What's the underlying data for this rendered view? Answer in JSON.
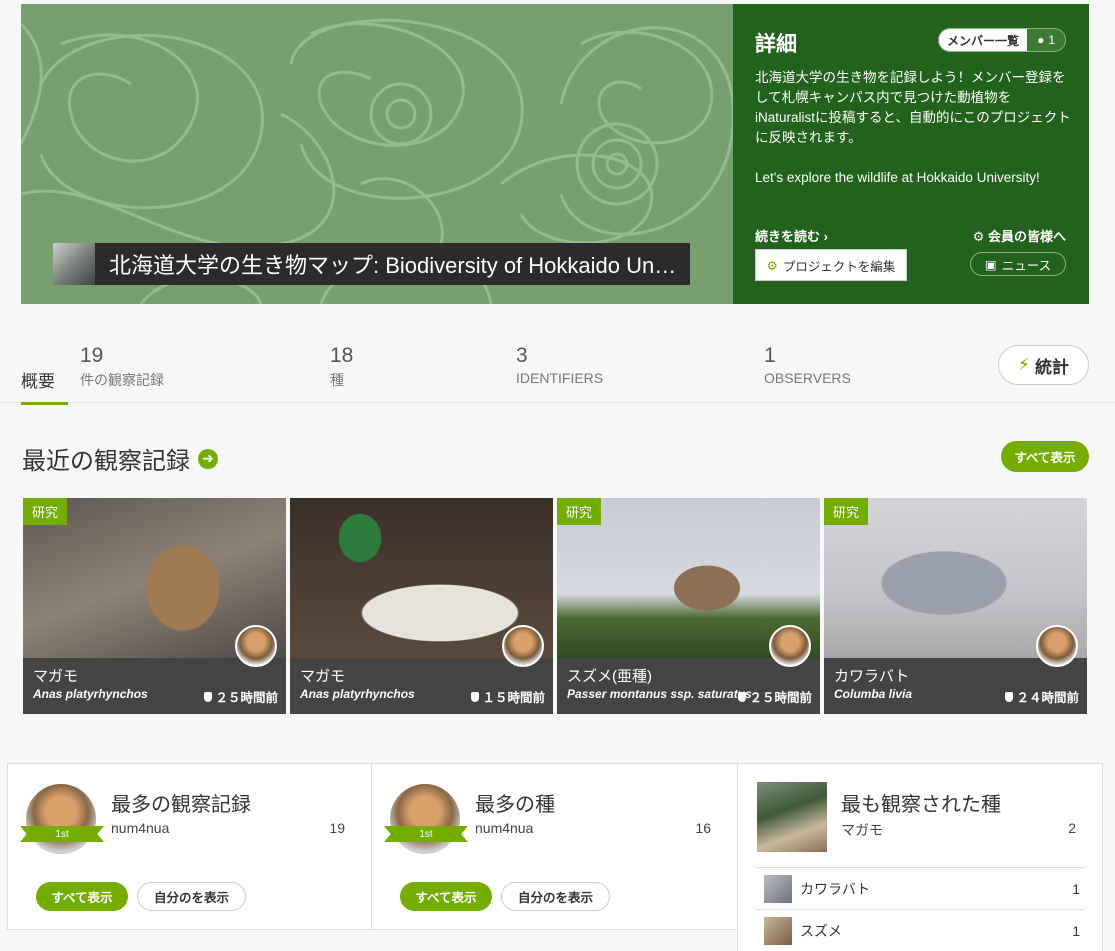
{
  "project": {
    "title": "北海道大学の生き物マップ: Biodiversity of Hokkaido University"
  },
  "details": {
    "heading": "詳細",
    "members_label": "メンバー一覧",
    "members_count": "1",
    "description_jp": "北海道大学の生き物を記録しよう！メンバー登録をして札幌キャンパス内で見つけた動植物をiNaturalistに投稿すると、自動的にこのプロジェクトに反映されます。",
    "description_en": "Let's explore the wildlife at Hokkaido University!",
    "read_more": "続きを読む ›",
    "members_link": "会員の皆様へ",
    "edit_button": "プロジェクトを編集",
    "news_button": "ニュース"
  },
  "stats": {
    "overview_tab": "概要",
    "observations": {
      "number": "19",
      "label": "件の観察記録"
    },
    "species": {
      "number": "18",
      "label": "種"
    },
    "identifiers": {
      "number": "3",
      "label": "IDENTIFIERS"
    },
    "observers": {
      "number": "1",
      "label": "OBSERVERS"
    },
    "stats_button": "統計"
  },
  "recent": {
    "title": "最近の観察記録",
    "show_all": "すべて表示",
    "items": [
      {
        "badge": "研究",
        "common": "マガモ",
        "scientific": "Anas platyrhynchos",
        "time": "２５時間前"
      },
      {
        "badge": "",
        "common": "マガモ",
        "scientific": "Anas platyrhynchos",
        "time": "１５時間前"
      },
      {
        "badge": "研究",
        "common": "スズメ(亜種)",
        "scientific": "Passer montanus ssp. saturatus",
        "time": "２５時間前"
      },
      {
        "badge": "研究",
        "common": "カワラバト",
        "scientific": "Columba livia",
        "time": "２４時間前"
      }
    ]
  },
  "leaderboards": {
    "most_observations": {
      "title": "最多の観察記録",
      "user": "num4nua",
      "count": "19",
      "rank": "1st"
    },
    "most_species": {
      "title": "最多の種",
      "user": "num4nua",
      "count": "16",
      "rank": "1st"
    },
    "show_all": "すべて表示",
    "show_mine": "自分のを表示",
    "most_observed": {
      "title": "最も観察された種",
      "top_name": "マガモ",
      "top_count": "2",
      "rows": [
        {
          "name": "カワラバト",
          "count": "1"
        },
        {
          "name": "スズメ",
          "count": "1"
        }
      ]
    }
  },
  "colors": {
    "accent": "#74ac00",
    "details_bg": "#23621c",
    "banner_bg": "#77a06e"
  }
}
